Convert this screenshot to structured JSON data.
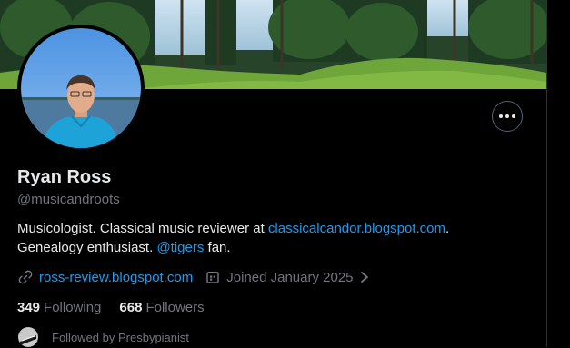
{
  "profile": {
    "name": "Ryan Ross",
    "handle": "@musicandroots",
    "bio": {
      "part1": "Musicologist. Classical music reviewer at ",
      "link1": "classicalcandor.blogspot.com",
      "part2": ".",
      "part3": "Genealogy enthusiast. ",
      "mention": "@tigers",
      "part4": " fan."
    },
    "website": "ross-review.blogspot.com",
    "joined": "Joined January 2025",
    "following_count": "349",
    "following_label": "Following",
    "followers_count": "668",
    "followers_label": "Followers",
    "followed_by": "Followed by Presbypianist"
  },
  "icons": {
    "more": "more-horizontal-icon",
    "link": "link-icon",
    "calendar": "calendar-icon",
    "chevron": "chevron-right-icon"
  },
  "colors": {
    "accent": "#1d9bf0",
    "muted": "#71767b",
    "text": "#e7e9ea",
    "background": "#000000"
  }
}
